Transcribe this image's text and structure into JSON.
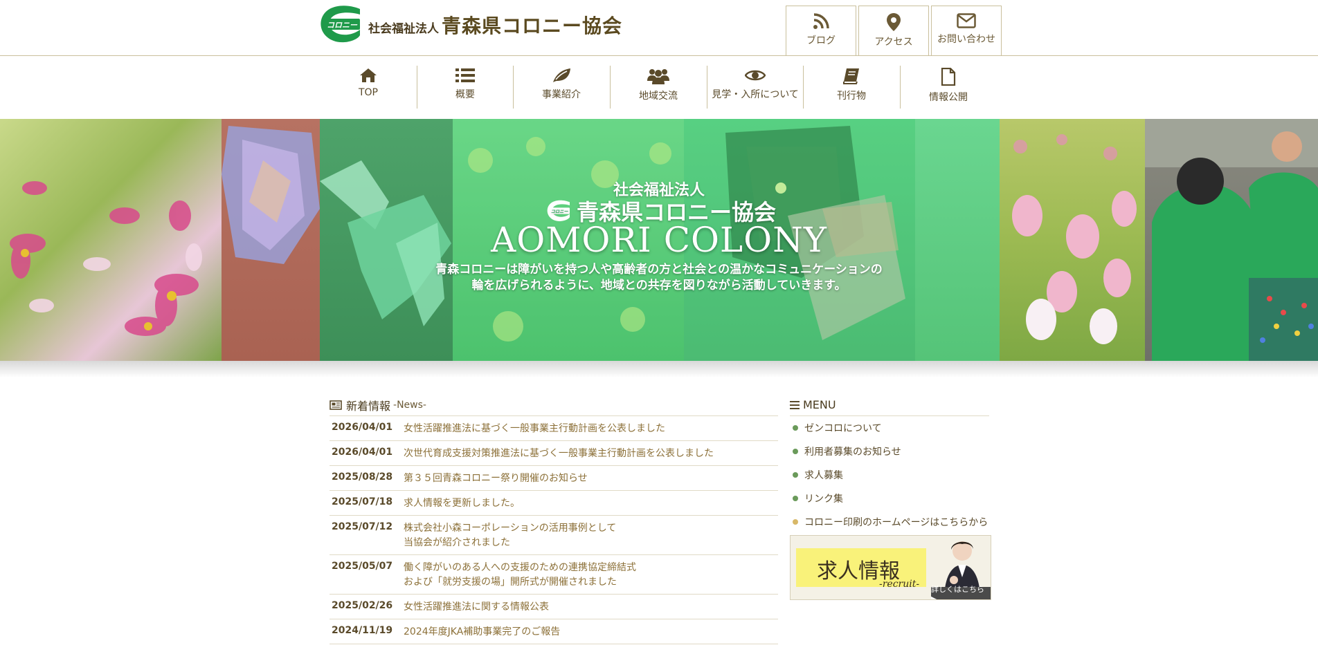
{
  "colors": {
    "brand_green": "#1f9a4a",
    "text_brown": "#5a4a2a",
    "link_gold": "#8c7038",
    "border_beige": "#c9bf9c"
  },
  "header": {
    "logo_mark": "コロニー",
    "org_type": "社会福祉法人",
    "org_name": "青森県コロニー協会",
    "utility": [
      {
        "label": "ブログ",
        "icon": "rss-icon"
      },
      {
        "label": "アクセス",
        "icon": "map-pin-icon"
      },
      {
        "label": "お問い合わせ",
        "icon": "envelope-icon"
      }
    ]
  },
  "nav": [
    {
      "label": "TOP",
      "icon": "home-icon"
    },
    {
      "label": "概要",
      "icon": "list-icon"
    },
    {
      "label": "事業紹介",
      "icon": "leaf-icon"
    },
    {
      "label": "地域交流",
      "icon": "users-icon"
    },
    {
      "label": "見学・入所について",
      "icon": "eye-icon"
    },
    {
      "label": "刊行物",
      "icon": "book-icon"
    },
    {
      "label": "情報公開",
      "icon": "document-icon"
    }
  ],
  "hero": {
    "sub": "社会福祉法人",
    "logo_mark": "コロニー",
    "name": "青森県コロニー協会",
    "english": "AOMORI COLONY",
    "desc_line1": "青森コロニーは障がいを持つ人や高齢者の方と社会との温かなコミュニケーションの",
    "desc_line2": "輪を広げられるように、地域との共存を図りながら活動していきます。"
  },
  "news": {
    "heading": "新着情報",
    "heading_en": "-News-",
    "items": [
      {
        "date": "2026/04/01",
        "lines": [
          "女性活躍推進法に基づく一般事業主行動計画を公表しました"
        ]
      },
      {
        "date": "2026/04/01",
        "lines": [
          "次世代育成支援対策推進法に基づく一般事業主行動計画を公表しました"
        ]
      },
      {
        "date": "2025/08/28",
        "lines": [
          "第３５回青森コロニー祭り開催のお知らせ"
        ]
      },
      {
        "date": "2025/07/18",
        "lines": [
          "求人情報を更新しました。"
        ]
      },
      {
        "date": "2025/07/12",
        "lines": [
          "株式会社小森コーポレーションの活用事例として",
          "当協会が紹介されました"
        ]
      },
      {
        "date": "2025/05/07",
        "lines": [
          "働く障がいのある人への支援のための連携協定締結式",
          "および「就労支援の場」開所式が開催されました"
        ]
      },
      {
        "date": "2025/02/26",
        "lines": [
          "女性活躍推進法に関する情報公表"
        ]
      },
      {
        "date": "2024/11/19",
        "lines": [
          "2024年度JKA補助事業完了のご報告"
        ]
      }
    ]
  },
  "menu": {
    "heading": "MENU",
    "items": [
      {
        "label": "ゼンコロについて"
      },
      {
        "label": "利用者募集のお知らせ"
      },
      {
        "label": "求人募集"
      },
      {
        "label": "リンク集"
      },
      {
        "label": "コロニー印刷のホームページはこちらから"
      }
    ]
  },
  "recruit": {
    "title": "求人情報",
    "english": "-recruit-",
    "button": "詳しくはこちら ▶"
  }
}
